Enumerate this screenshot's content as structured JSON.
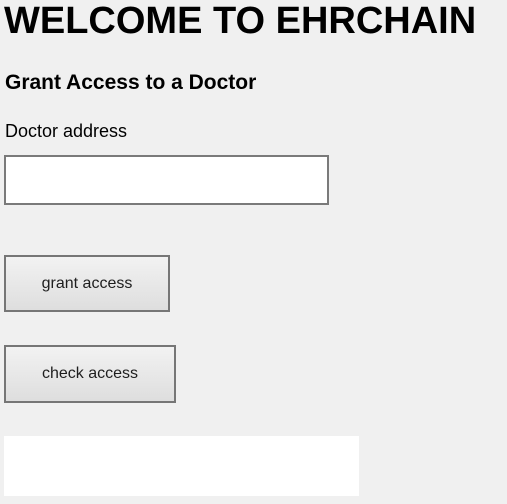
{
  "header": {
    "title": "WELCOME TO EHRCHAIN"
  },
  "grant_section": {
    "title": "Grant Access to a Doctor",
    "doctor_address_label": "Doctor address",
    "doctor_address_value": "",
    "grant_button_label": "grant access",
    "check_button_label": "check access"
  },
  "result": {
    "text": ""
  }
}
